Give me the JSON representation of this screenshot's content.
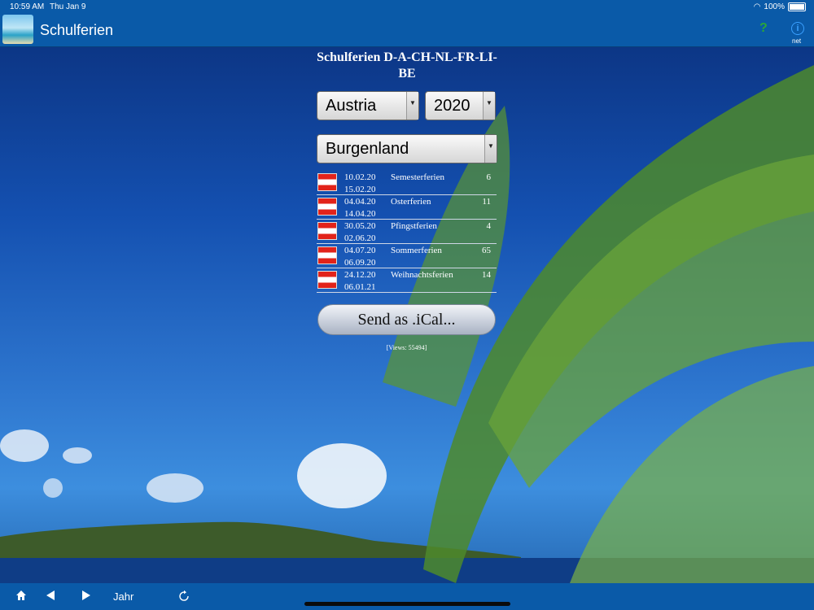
{
  "status_bar": {
    "time": "10:59 AM",
    "date": "Thu Jan 9",
    "wifi_icon": "wifi-icon",
    "battery": "100%"
  },
  "nav": {
    "title": "Schulferien",
    "help_label": "?",
    "info_label": "i",
    "info_sub": "net",
    "app_icon": "beach-app-icon"
  },
  "main": {
    "title": "Schulferien D-A-CH-NL-FR-LI-BE",
    "country_select": "Austria",
    "year_select": "2020",
    "region_select": "Burgenland",
    "holidays": [
      {
        "start": "10.02.20",
        "end": "15.02.20",
        "name": "Semesterferien",
        "count": "6"
      },
      {
        "start": "04.04.20",
        "end": "14.04.20",
        "name": "Osterferien",
        "count": "11"
      },
      {
        "start": "30.05.20",
        "end": "02.06.20",
        "name": "Pfingstferien",
        "count": "4"
      },
      {
        "start": "04.07.20",
        "end": "06.09.20",
        "name": "Sommerferien",
        "count": "65"
      },
      {
        "start": "24.12.20",
        "end": "06.01.21",
        "name": "Weihnachtsferien",
        "count": "14"
      }
    ],
    "send_button": "Send as .iCal...",
    "views": "[Views: 55494]"
  },
  "toolbar": {
    "jahr_label": "Jahr"
  },
  "colors": {
    "bar": "#0a5aa8",
    "flag_red": "#e2231a"
  }
}
